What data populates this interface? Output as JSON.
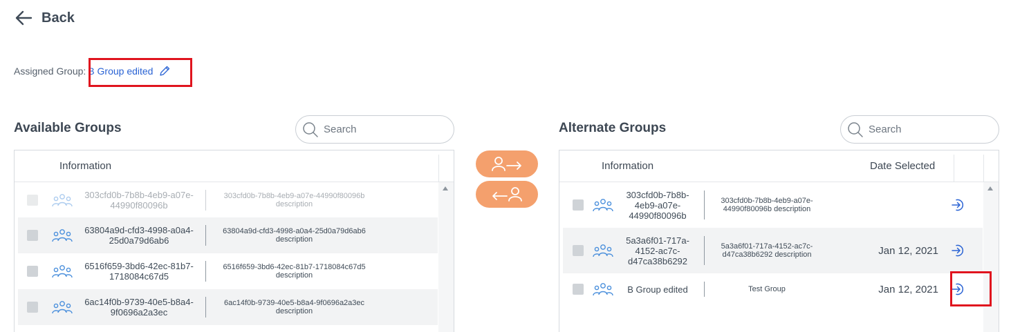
{
  "nav": {
    "back_label": "Back"
  },
  "assigned": {
    "label": "Assigned Group:",
    "value": "B Group edited"
  },
  "available": {
    "title": "Available Groups",
    "search_placeholder": "Search",
    "column_info": "Information",
    "rows": [
      {
        "name": "303cfd0b-7b8b-4eb9-a07e-44990f80096b",
        "desc": "303cfd0b-7b8b-4eb9-a07e-44990f80096b description",
        "disabled": true
      },
      {
        "name": "63804a9d-cfd3-4998-a0a4-25d0a79d6ab6",
        "desc": "63804a9d-cfd3-4998-a0a4-25d0a79d6ab6 description"
      },
      {
        "name": "6516f659-3bd6-42ec-81b7-1718084c67d5",
        "desc": "6516f659-3bd6-42ec-81b7-1718084c67d5 description"
      },
      {
        "name": "6ac14f0b-9739-40e5-b8a4-9f0696a2a3ec",
        "desc": "6ac14f0b-9739-40e5-b8a4-9f0696a2a3ec description"
      }
    ]
  },
  "alternate": {
    "title": "Alternate Groups",
    "search_placeholder": "Search",
    "column_info": "Information",
    "column_date": "Date Selected",
    "rows": [
      {
        "name": "303cfd0b-7b8b-4eb9-a07e-44990f80096b",
        "desc": "303cfd0b-7b8b-4eb9-a07e-44990f80096b description",
        "date": ""
      },
      {
        "name": "5a3a6f01-717a-4152-ac7c-d47ca38b6292",
        "desc": "5a3a6f01-717a-4152-ac7c-d47ca38b6292 description",
        "date": "Jan 12, 2021"
      },
      {
        "name": "B Group edited",
        "desc": "Test Group",
        "date": "Jan 12, 2021"
      }
    ]
  },
  "colors": {
    "accent": "#2a63d4",
    "orange": "#f4a06d",
    "highlight": "#e0141e",
    "icon_blue": "#4a8fdc"
  },
  "icons": [
    "arrow-left-icon",
    "pencil-icon",
    "search-icon",
    "group-icon",
    "user-arrow-right-icon",
    "user-arrow-left-icon",
    "sign-in-icon"
  ]
}
